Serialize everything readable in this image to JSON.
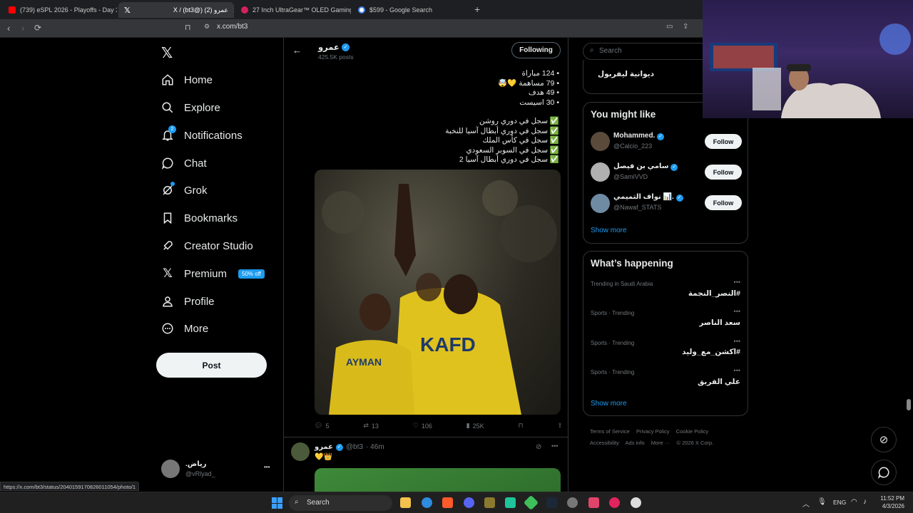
{
  "browser": {
    "tabs": [
      {
        "title": "(739) eSPL 2026 - Playoffs - Day 3 | ...",
        "color": "#ff0000"
      },
      {
        "title": "X / (bt3@) عمرو (2)",
        "color": "#ffffff"
      },
      {
        "title": "27 Inch UltraGear™ OLED Gaming M...",
        "color": "#d4215c"
      },
      {
        "title": "$599 - Google Search",
        "color": "#4285f4"
      }
    ],
    "url": "x.com/bt3",
    "new_tab": "+"
  },
  "nav": {
    "items": [
      {
        "label": "Home",
        "icon": "home-icon"
      },
      {
        "label": "Explore",
        "icon": "search-icon"
      },
      {
        "label": "Notifications",
        "icon": "bell-icon",
        "badge": "2"
      },
      {
        "label": "Chat",
        "icon": "chat-icon"
      },
      {
        "label": "Grok",
        "icon": "grok-icon"
      },
      {
        "label": "Bookmarks",
        "icon": "bookmark-icon"
      },
      {
        "label": "Creator Studio",
        "icon": "rocket-icon"
      },
      {
        "label": "Premium",
        "icon": "x-logo-icon",
        "badge": "50% off"
      },
      {
        "label": "Profile",
        "icon": "person-icon"
      },
      {
        "label": "More",
        "icon": "more-circle-icon"
      }
    ],
    "post_label": "Post",
    "account": {
      "name": "رياض.",
      "handle": "@vRlyad_",
      "more": "•••"
    }
  },
  "profile_header": {
    "name": "عمرو",
    "posts": "425.5K posts",
    "follow_state": "Following"
  },
  "tweet": {
    "stats_lines": [
      "• 124 مباراة",
      "• 79 مساهمة 💛🤯",
      "• 49 هدف",
      "• 30 اسيست"
    ],
    "achievement_lines": [
      "✅ سجل في دوري روشن",
      "✅ سجل في دوري أبطال آسيا للنخبة",
      "✅ سجل في كأس الملك",
      "✅ سجل في السوبر السعودي",
      "✅ سجل في دوري أبطال آسيا 2"
    ],
    "photo_jersey_text": "KAFD",
    "photo_back_name": "AYMAN",
    "replies": "5",
    "reposts": "13",
    "likes": "106",
    "views": "25K"
  },
  "next_tweet": {
    "name": "عمرو",
    "handle": "@bt3",
    "time": "· 46m",
    "text": "💛👑"
  },
  "status_url": "https://x.com/bt3/status/2040159170826011054/photo/1",
  "sidebar": {
    "search_placeholder": "Search",
    "space_title": "ديوانية ليفربول",
    "you_might_like": {
      "title": "You might like",
      "users": [
        {
          "name": "Mohammed.",
          "handle": "@Calcio_223",
          "button": "Follow"
        },
        {
          "name": "سامي بن فيصل",
          "handle": "@SamiVVD",
          "button": "Follow"
        },
        {
          "name": "نواف التميمي 📊.",
          "handle": "@Nawaf_STATS",
          "button": "Follow"
        }
      ],
      "show_more": "Show more"
    },
    "whats_happening": {
      "title": "What’s happening",
      "trends": [
        {
          "meta": "Trending in Saudi Arabia",
          "name": "#النصر_النجمة"
        },
        {
          "meta": "Sports · Trending",
          "name": "سعد الناصر"
        },
        {
          "meta": "Sports · Trending",
          "name": "#اكشن_مع_وليد"
        },
        {
          "meta": "Sports · Trending",
          "name": "علي الفريق"
        }
      ],
      "show_more": "Show more",
      "more": "•••"
    },
    "footer": [
      "Terms of Service",
      "Privacy Policy",
      "Cookie Policy",
      "Accessibility",
      "Ads info",
      "More ···",
      "© 2026 X Corp."
    ]
  },
  "taskbar": {
    "search": "Search",
    "lang": "ENG",
    "time": "11:52 PM",
    "date": "4/3/2026"
  }
}
